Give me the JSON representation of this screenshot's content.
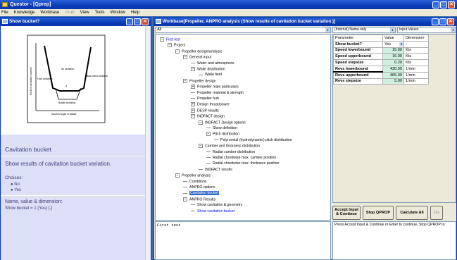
{
  "app": {
    "title": "Questor - [Qprep]"
  },
  "menubar": [
    "File",
    "Knowledge",
    "Workbase",
    "Grab",
    "View",
    "Tools",
    "Window",
    "Help"
  ],
  "left_window": {
    "title": "Show bucket?",
    "diagram": {
      "x_label": "Section angle of attack",
      "y_label": "Section cavitation number",
      "labels": [
        "Face cavitation",
        "No cavitation",
        "Back sheet cavitation",
        "Bubble cavitation",
        "α",
        "σ"
      ]
    },
    "heading": "Cavitation bucket",
    "question": "Show results of cavitation bucket variation.",
    "choices_label": "Choices:",
    "choices": [
      "No",
      "Yes"
    ],
    "nvd_heading": "Name, value & dimension:",
    "nvd_value": "Show bucket = 1 (Yes) [-]"
  },
  "right_window": {
    "title": "Workbase[Propeller, ANPRO analysis (Show results of cavitation bucket variation.)]",
    "filter": "All",
    "name_filter": "(Internal) Name only",
    "value_filter": "Input Values",
    "input_text": "First test",
    "status_text": "Press Accept Input & Continue or Enter to continue, Stop QPROP to"
  },
  "tree": [
    {
      "label": "First test",
      "depth": 0,
      "exp": "-",
      "color": "#0000cc"
    },
    {
      "label": "Project",
      "depth": 1,
      "exp": "-"
    },
    {
      "label": "Propeller design/analysis",
      "depth": 2,
      "exp": "-"
    },
    {
      "label": "General input",
      "depth": 3,
      "exp": "-"
    },
    {
      "label": "Water and atmosphere",
      "depth": 4,
      "exp": ""
    },
    {
      "label": "Wake distribution",
      "depth": 4,
      "exp": "-"
    },
    {
      "label": "Wake field",
      "depth": 5,
      "exp": ""
    },
    {
      "label": "Propeller design",
      "depth": 3,
      "exp": "-"
    },
    {
      "label": "Propeller main particulars",
      "depth": 4,
      "exp": "+"
    },
    {
      "label": "Propeller material & strength",
      "depth": 4,
      "exp": ""
    },
    {
      "label": "Propeller hub",
      "depth": 4,
      "exp": ""
    },
    {
      "label": "Design thrust/power",
      "depth": 4,
      "exp": "+"
    },
    {
      "label": "DESP results",
      "depth": 4,
      "exp": "+"
    },
    {
      "label": "INDFACT design",
      "depth": 4,
      "exp": "-"
    },
    {
      "label": "INDFACT Design options",
      "depth": 5,
      "exp": "-"
    },
    {
      "label": "Skew definition",
      "depth": 6,
      "exp": ""
    },
    {
      "label": "Pitch distribution",
      "depth": 6,
      "exp": "-"
    },
    {
      "label": "Polynomial (hydrodynamic) pitch distribution",
      "depth": 7,
      "exp": ""
    },
    {
      "label": "Camber and thickness distribution",
      "depth": 5,
      "exp": "-"
    },
    {
      "label": "Radial camber distribution",
      "depth": 6,
      "exp": ""
    },
    {
      "label": "Radial chordwise max. camber position",
      "depth": 6,
      "exp": ""
    },
    {
      "label": "Radial chordwise max. thickness position",
      "depth": 6,
      "exp": ""
    },
    {
      "label": "INDFACT results",
      "depth": 5,
      "exp": ""
    },
    {
      "label": "Propeller analysis",
      "depth": 2,
      "exp": "-"
    },
    {
      "label": "Conditions",
      "depth": 3,
      "exp": ""
    },
    {
      "label": "ANPRO options",
      "depth": 3,
      "exp": ""
    },
    {
      "label": "Cavitation bucket",
      "depth": 3,
      "exp": "",
      "selected": true
    },
    {
      "label": "ANPRO Results",
      "depth": 3,
      "exp": "-"
    },
    {
      "label": "Show cavitation & geometry",
      "depth": 4,
      "exp": ""
    },
    {
      "label": "Show cavitation bucket",
      "depth": 4,
      "exp": "",
      "color": "#0000ff"
    }
  ],
  "params": {
    "headers": [
      "Parameter",
      "Value",
      "Dimension"
    ],
    "rows": [
      {
        "name": "Show bucket?",
        "value": "Yes",
        "dim": "-",
        "dropdown": true
      },
      {
        "name": "Speed lowerbound",
        "value": "15.00",
        "dim": "Kts"
      },
      {
        "name": "Speed upperbound",
        "value": "16.00",
        "dim": "Kts"
      },
      {
        "name": "Speed stepsize",
        "value": "0.20",
        "dim": "Kts"
      },
      {
        "name": "Revs lowerbound",
        "value": "430.00",
        "dim": "1/min"
      },
      {
        "name": "Revs upperbound",
        "value": "465.00",
        "dim": "1/min"
      },
      {
        "name": "Revs stepsize",
        "value": "5.00",
        "dim": "1/min"
      }
    ]
  },
  "buttons": {
    "accept": "Accept Input & Continue",
    "stop": "Stop QPROP",
    "calc": "Calculate All",
    "file": "File"
  }
}
